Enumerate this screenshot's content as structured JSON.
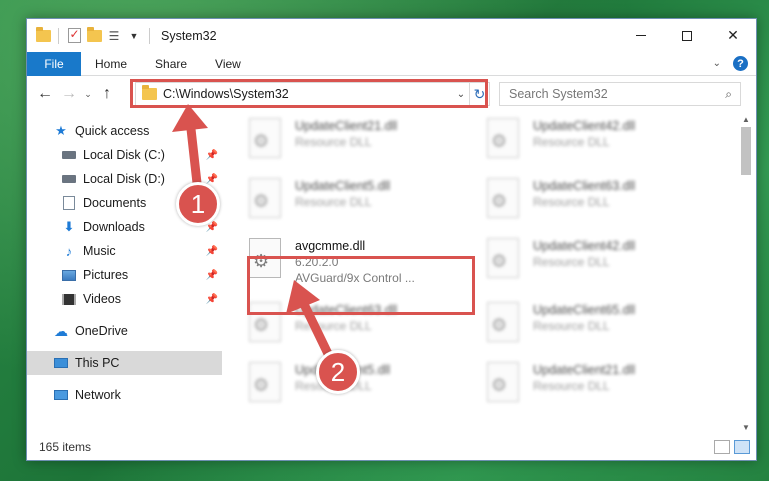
{
  "window": {
    "title": "System32",
    "controls": {
      "minimize": "—",
      "maximize": "☐",
      "close": "✕"
    }
  },
  "ribbon": {
    "tabs": [
      "File",
      "Home",
      "Share",
      "View"
    ]
  },
  "nav": {
    "address": "C:\\Windows\\System32",
    "search_placeholder": "Search System32"
  },
  "sidebar": {
    "items": [
      {
        "label": "Quick access",
        "icon": "star-icon"
      },
      {
        "label": "Local Disk (C:)",
        "icon": "drive-icon",
        "pinned": true
      },
      {
        "label": "Local Disk (D:)",
        "icon": "drive-icon",
        "pinned": true
      },
      {
        "label": "Documents",
        "icon": "documents-icon",
        "pinned": true
      },
      {
        "label": "Downloads",
        "icon": "downloads-icon",
        "pinned": true
      },
      {
        "label": "Music",
        "icon": "music-icon",
        "pinned": true
      },
      {
        "label": "Pictures",
        "icon": "pictures-icon",
        "pinned": true
      },
      {
        "label": "Videos",
        "icon": "videos-icon",
        "pinned": true
      },
      {
        "label": "OneDrive",
        "icon": "cloud-icon"
      },
      {
        "label": "This PC",
        "icon": "computer-icon",
        "selected": true
      },
      {
        "label": "Network",
        "icon": "network-icon"
      }
    ]
  },
  "files": [
    {
      "name": "UpdateClient21.dll",
      "sub1": "Resource DLL",
      "sub2": "",
      "blurred": true
    },
    {
      "name": "UpdateClient42.dll",
      "sub1": "Resource DLL",
      "sub2": "",
      "blurred": true
    },
    {
      "name": "UpdateClient5.dll",
      "sub1": "Resource DLL",
      "sub2": "",
      "blurred": true
    },
    {
      "name": "UpdateClient63.dll",
      "sub1": "Resource DLL",
      "sub2": "",
      "blurred": true
    },
    {
      "name": "avgcmme.dll",
      "sub1": "6.20.2.0",
      "sub2": "AVGuard/9x Control ...",
      "blurred": false
    },
    {
      "name": "UpdateClient42.dll",
      "sub1": "Resource DLL",
      "sub2": "",
      "blurred": true
    },
    {
      "name": "UpdateClient63.dll",
      "sub1": "Resource DLL",
      "sub2": "",
      "blurred": true
    },
    {
      "name": "UpdateClient65.dll",
      "sub1": "Resource DLL",
      "sub2": "",
      "blurred": true
    },
    {
      "name": "UpdateClient5.dll",
      "sub1": "Resource DLL",
      "sub2": "",
      "blurred": true
    },
    {
      "name": "UpdateClient21.dll",
      "sub1": "Resource DLL",
      "sub2": "",
      "blurred": true
    }
  ],
  "status": {
    "item_count": "165 items"
  },
  "annotations": {
    "step1": "1",
    "step2": "2",
    "color": "#d9534f"
  }
}
